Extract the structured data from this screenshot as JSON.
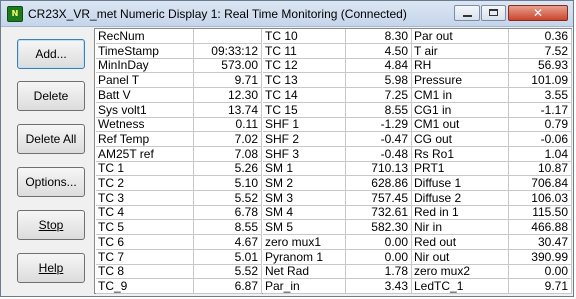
{
  "window": {
    "title": "CR23X_VR_met Numeric Display 1: Real Time Monitoring (Connected)",
    "icon": "app-logo-icon",
    "close_glyph": "✕"
  },
  "buttons": [
    {
      "label": "Add...",
      "name": "add-button"
    },
    {
      "label": "Delete",
      "name": "delete-button"
    },
    {
      "label": "Delete All",
      "name": "delete-all-button"
    },
    {
      "label": "Options...",
      "name": "options-button"
    },
    {
      "label": "Stop",
      "name": "stop-button"
    },
    {
      "label": "Help",
      "name": "help-button"
    }
  ],
  "table": {
    "rows": [
      {
        "c1": "RecNum",
        "v1": "",
        "c2": "TC  10",
        "v2": "8.30",
        "c3": "Par  out",
        "v3": "0.36"
      },
      {
        "c1": "TimeStamp",
        "v1": "09:33:12",
        "c2": "TC  11",
        "v2": "4.50",
        "c3": "T  air",
        "v3": "7.52"
      },
      {
        "c1": "MinInDay",
        "v1": "573.00",
        "c2": "TC  12",
        "v2": "4.84",
        "c3": "RH",
        "v3": "56.93"
      },
      {
        "c1": "Panel  T",
        "v1": "9.71",
        "c2": "TC  13",
        "v2": "5.98",
        "c3": "Pressure",
        "v3": "101.09"
      },
      {
        "c1": "Batt  V",
        "v1": "12.30",
        "c2": "TC  14",
        "v2": "7.25",
        "c3": "CM1  in",
        "v3": "3.55"
      },
      {
        "c1": "Sys  volt1",
        "v1": "13.74",
        "c2": "TC  15",
        "v2": "8.55",
        "c3": "CG1  in",
        "v3": "-1.17"
      },
      {
        "c1": "Wetness",
        "v1": "0.11",
        "c2": "SHF   1",
        "v2": "-1.29",
        "c3": "CM1  out",
        "v3": "0.79"
      },
      {
        "c1": "Ref  Temp",
        "v1": "7.02",
        "c2": "SHF   2",
        "v2": "-0.47",
        "c3": "CG  out",
        "v3": "-0.06"
      },
      {
        "c1": "AM25T  ref",
        "v1": "7.08",
        "c2": "SHF   3",
        "v2": "-0.48",
        "c3": "Rs  Ro1",
        "v3": "1.04"
      },
      {
        "c1": "TC  1",
        "v1": "5.26",
        "c2": "SM  1",
        "v2": "710.13",
        "c3": "PRT1",
        "v3": "10.87"
      },
      {
        "c1": "TC  2",
        "v1": "5.10",
        "c2": "SM  2",
        "v2": "628.86",
        "c3": "Diffuse  1",
        "v3": "706.84"
      },
      {
        "c1": "TC  3",
        "v1": "5.52",
        "c2": "SM  3",
        "v2": "757.45",
        "c3": "Diffuse  2",
        "v3": "106.03"
      },
      {
        "c1": "TC  4",
        "v1": "6.78",
        "c2": "SM  4",
        "v2": "732.61",
        "c3": "Red  in  1",
        "v3": "115.50"
      },
      {
        "c1": "TC  5",
        "v1": "8.55",
        "c2": "SM  5",
        "v2": "582.30",
        "c3": "Nir  in",
        "v3": "466.88"
      },
      {
        "c1": "TC  6",
        "v1": "4.67",
        "c2": "zero  mux1",
        "v2": "0.00",
        "c3": "Red  out",
        "v3": "30.47"
      },
      {
        "c1": "TC  7",
        "v1": "5.01",
        "c2": "Pyranom  1",
        "v2": "0.00",
        "c3": "Nir  out",
        "v3": "390.99"
      },
      {
        "c1": "TC  8",
        "v1": "5.52",
        "c2": "Net  Rad",
        "v2": "1.78",
        "c3": "zero  mux2",
        "v3": "0.00"
      },
      {
        "c1": "TC_9",
        "v1": "6.87",
        "c2": "Par_in",
        "v2": "3.43",
        "c3": "LedTC_1",
        "v3": "9.71"
      }
    ]
  }
}
